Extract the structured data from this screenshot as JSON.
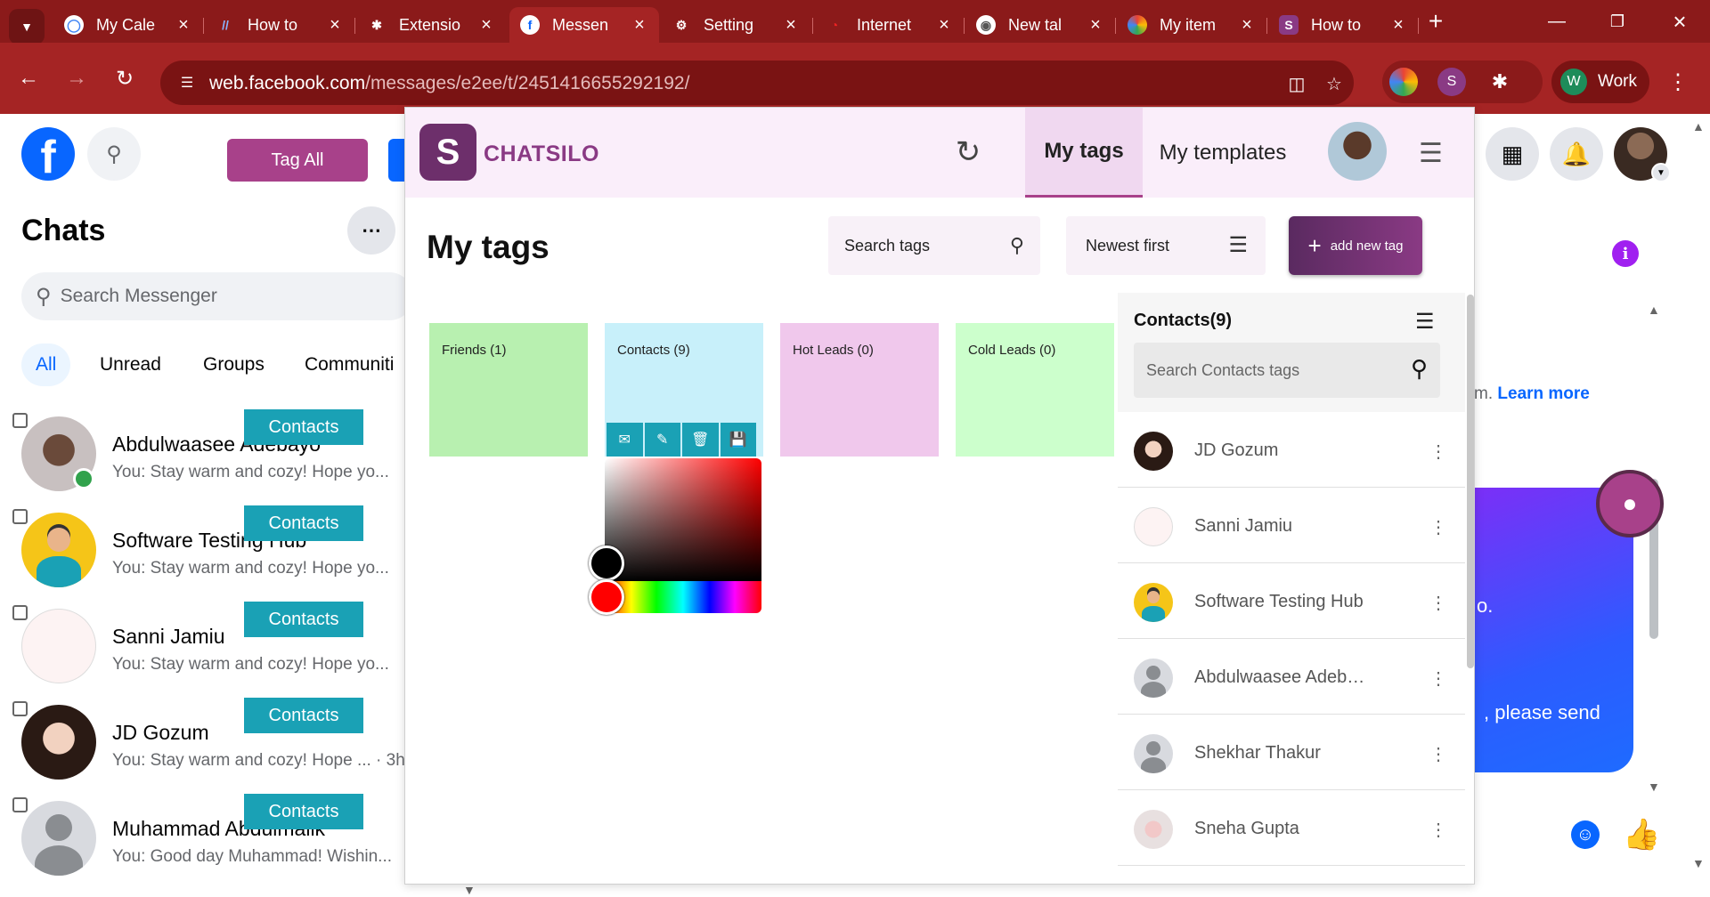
{
  "browser": {
    "tabs": [
      {
        "title": "My Cale",
        "icon": "google-calendar-icon"
      },
      {
        "title": "How to",
        "icon": "slashes-icon"
      },
      {
        "title": "Extensio",
        "icon": "puzzle-icon"
      },
      {
        "title": "Messen",
        "icon": "facebook-icon",
        "active": true
      },
      {
        "title": "Setting",
        "icon": "gear-icon"
      },
      {
        "title": "Internet",
        "icon": "speedometer-icon"
      },
      {
        "title": "New tal",
        "icon": "chrome-icon"
      },
      {
        "title": "My item",
        "icon": "colorful-ring-icon"
      },
      {
        "title": "How to",
        "icon": "chatsilo-icon"
      }
    ],
    "url_domain": "web.facebook.com",
    "url_path": "/messages/e2ee/t/2451416655292192/",
    "profile_label": "Work",
    "profile_initial": "W"
  },
  "facebook": {
    "tag_all_label": "Tag All",
    "chats_title": "Chats",
    "search_placeholder": "Search Messenger",
    "filter_tabs": [
      "All",
      "Unread",
      "Groups",
      "Communiti"
    ],
    "chats": [
      {
        "name": "Abdulwaasee Adebayo",
        "preview": "You: Stay warm and cozy! Hope yo...",
        "badge": "Contacts",
        "online": true
      },
      {
        "name": "Software Testing Hub",
        "preview": "You: Stay warm and cozy! Hope yo...",
        "badge": "Contacts"
      },
      {
        "name": "Sanni Jamiu",
        "preview": "You: Stay warm and cozy! Hope yo...",
        "badge": "Contacts"
      },
      {
        "name": "JD Gozum",
        "preview": "You: Stay warm and cozy! Hope ... · 3h",
        "badge": "Contacts"
      },
      {
        "name": "Muhammad Abdulmalik",
        "preview": "You: Good day Muhammad! Wishin...",
        "badge": "Contacts"
      }
    ],
    "right_pane": {
      "partial_text": "m.",
      "learn_more": "Learn more",
      "msg_fragment_1": "o.",
      "msg_fragment_2": ", please send"
    }
  },
  "chatsilo": {
    "brand": "CHATSILO",
    "tabs": [
      "My tags",
      "My templates"
    ],
    "page_title": "My tags",
    "search_placeholder": "Search tags",
    "sort_label": "Newest first",
    "add_button": "add new tag",
    "tags": [
      {
        "label": "Friends (1)",
        "color": "#b8f0b0"
      },
      {
        "label": "Contacts (9)",
        "color": "#c8f0fa"
      },
      {
        "label": "Hot Leads (0)",
        "color": "#f0c8ec"
      },
      {
        "label": "Cold Leads (0)",
        "color": "#ccffcc"
      }
    ],
    "tag_action_icons": [
      "envelope-icon",
      "pencil-icon",
      "trash-icon",
      "save-icon"
    ],
    "side": {
      "title": "Contacts(9)",
      "search_placeholder": "Search Contacts tags",
      "contacts": [
        "JD Gozum",
        "Sanni Jamiu",
        "Software Testing Hub",
        "Abdulwaasee Adeb…",
        "Shekhar Thakur",
        "Sneha Gupta"
      ]
    }
  }
}
